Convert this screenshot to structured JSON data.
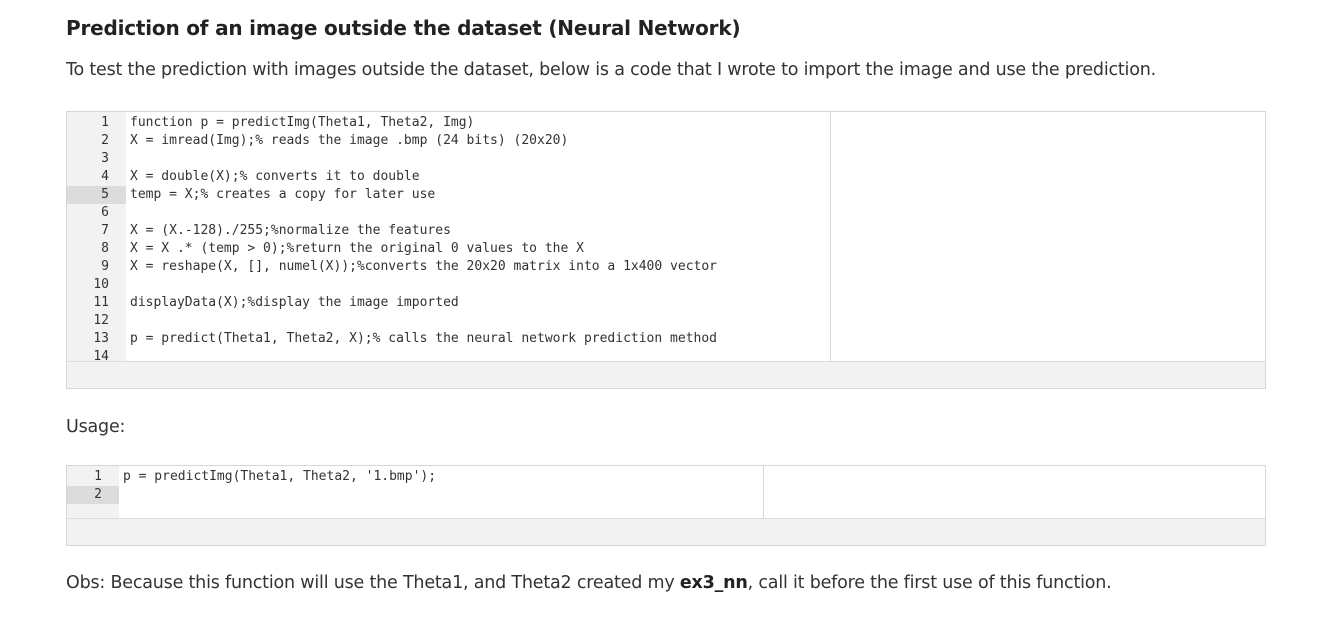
{
  "heading": "Prediction of an image outside the dataset (Neural Network)",
  "intro": "To test the prediction with images outside the dataset, below is a code that I wrote to import the image and use the prediction.",
  "code_block_1": {
    "active_line": 5,
    "lines": [
      "function p = predictImg(Theta1, Theta2, Img)",
      "X = imread(Img);% reads the image .bmp (24 bits) (20x20)",
      "",
      "X = double(X);% converts it to double",
      "temp = X;% creates a copy for later use",
      "",
      "X = (X.-128)./255;%normalize the features",
      "X = X .* (temp > 0);%return the original 0 values to the X",
      "X = reshape(X, [], numel(X));%converts the 20x20 matrix into a 1x400 vector",
      "",
      "displayData(X);%display the image imported",
      "",
      "p = predict(Theta1, Theta2, X);% calls the neural network prediction method",
      ""
    ]
  },
  "usage_label": "Usage:",
  "code_block_2": {
    "active_line": 2,
    "lines": [
      "p = predictImg(Theta1, Theta2, '1.bmp');",
      ""
    ]
  },
  "obs": {
    "prefix": "Obs: Because this function will use the Theta1, and Theta2 created my ",
    "bold": "ex3_nn",
    "suffix": ", call it before the first use of this function."
  }
}
